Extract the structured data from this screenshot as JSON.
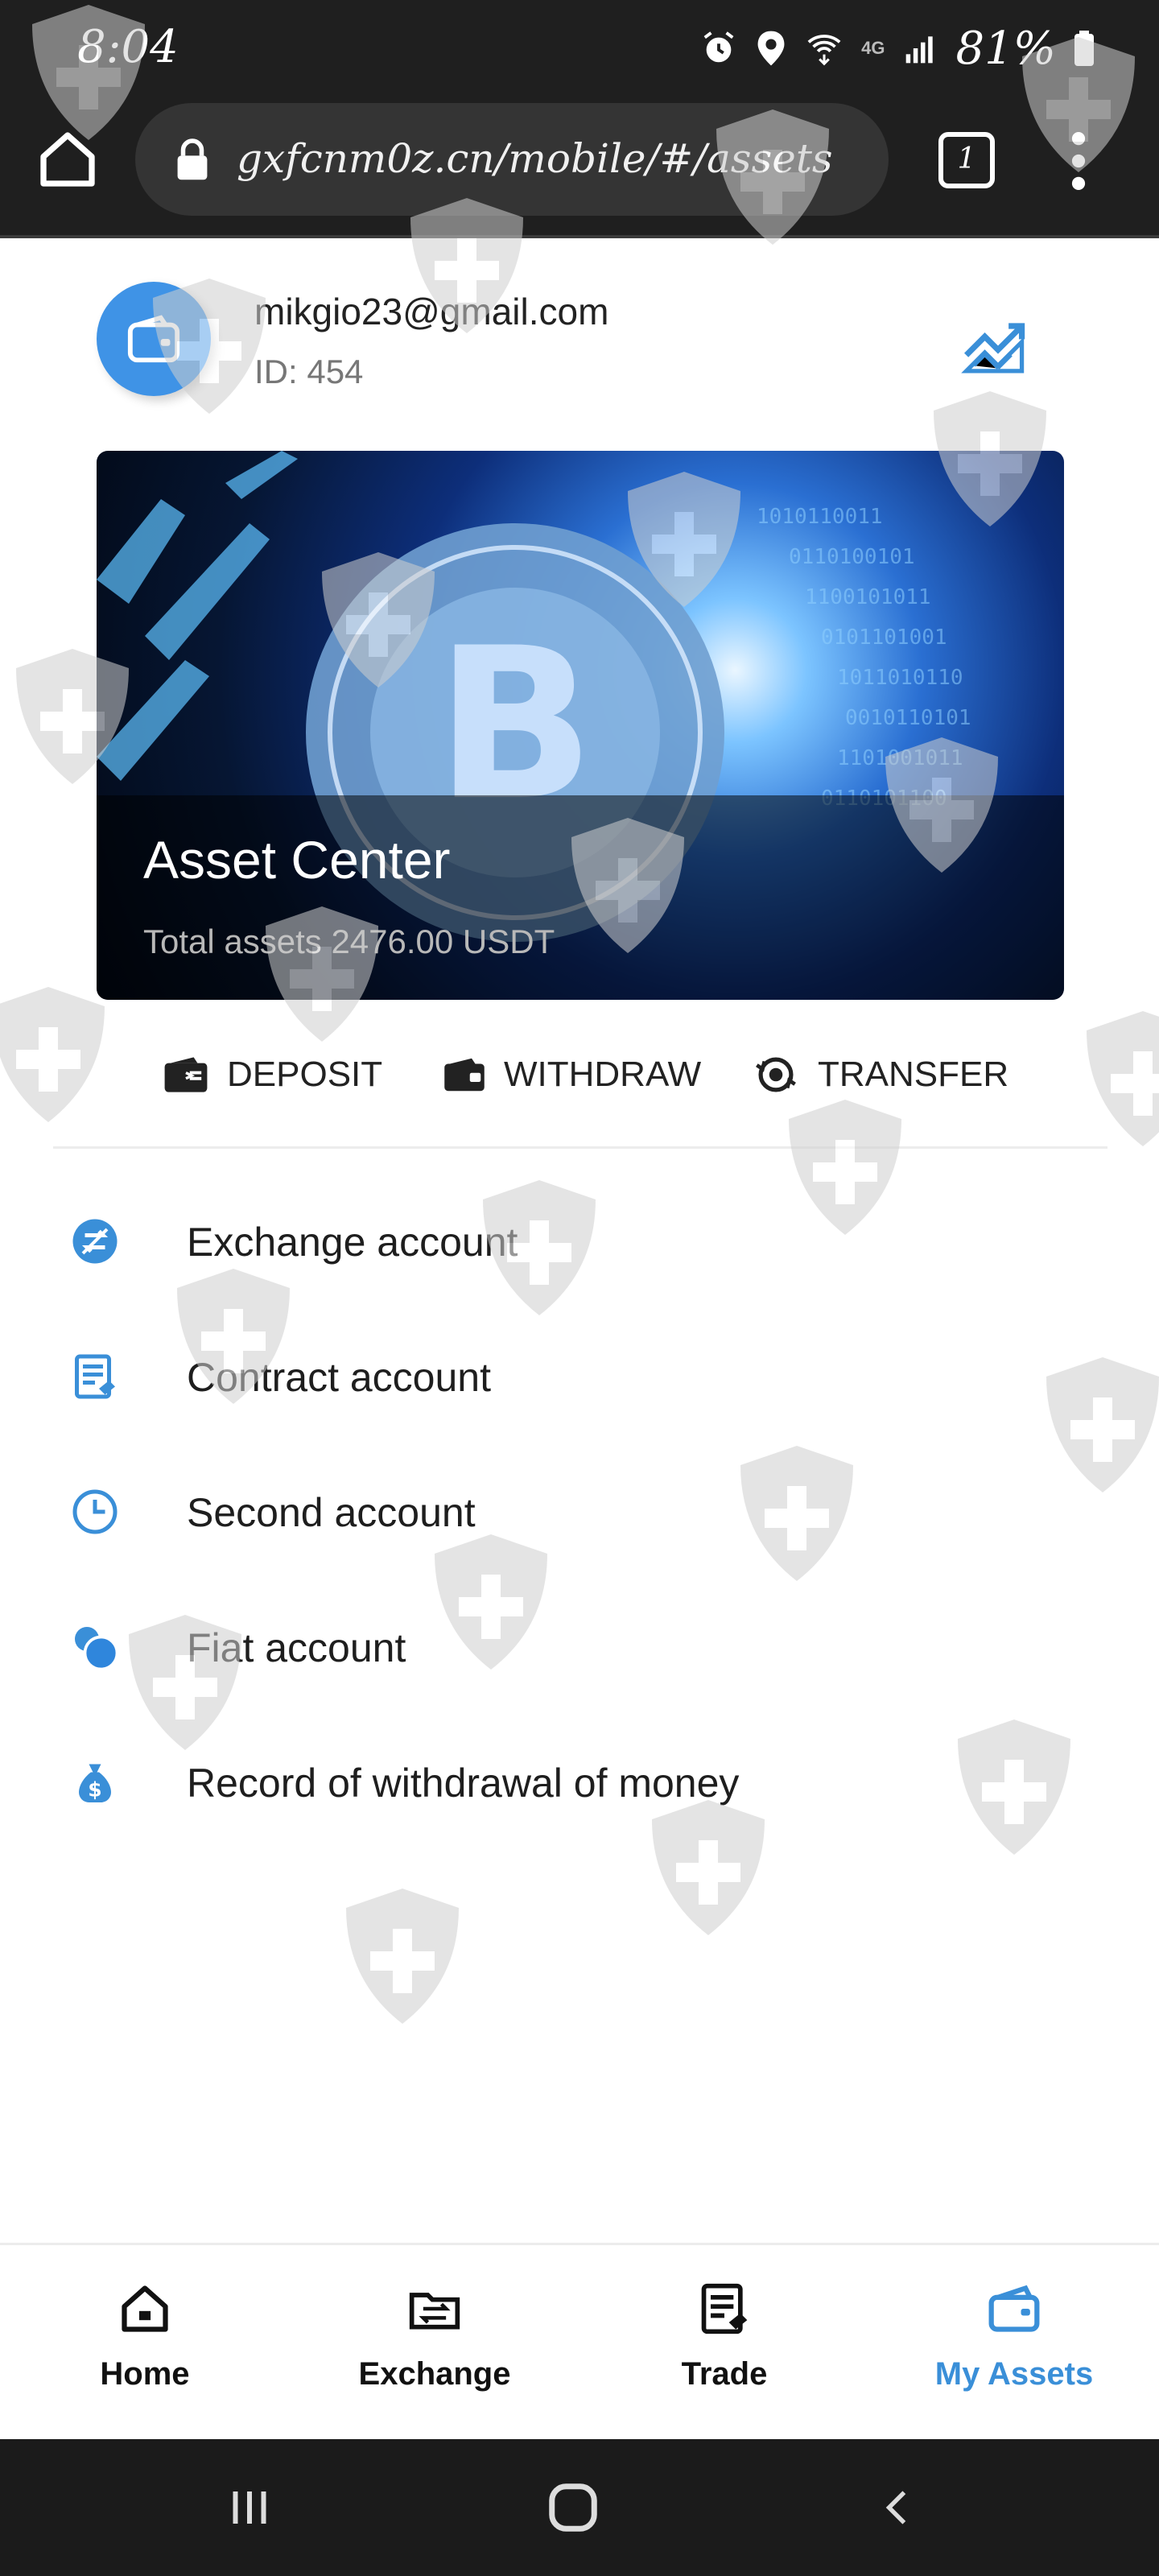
{
  "status_bar": {
    "time": "8:04",
    "network": "4G",
    "battery": "81%",
    "icons": [
      "alarm-icon",
      "location-icon",
      "wifi-icon",
      "signal-icon",
      "battery-icon"
    ]
  },
  "browser": {
    "url": "gxfcnm0z.cn/mobile/#/assets",
    "tab_count": "1"
  },
  "account": {
    "email": "mikgio23@gmail.com",
    "id": "ID: 454"
  },
  "banner": {
    "title": "Asset Center",
    "subtitle": "Total assets 2476.00 USDT"
  },
  "actions": [
    {
      "label": "DEPOSIT",
      "icon": "wallet-in-icon"
    },
    {
      "label": "WITHDRAW",
      "icon": "wallet-out-icon"
    },
    {
      "label": "TRANSFER",
      "icon": "transfer-icon"
    }
  ],
  "accounts": [
    {
      "label": "Exchange account",
      "icon": "exchange-icon"
    },
    {
      "label": "Contract account",
      "icon": "contract-icon"
    },
    {
      "label": "Second account",
      "icon": "clock-icon"
    },
    {
      "label": "Fiat account",
      "icon": "coins-icon"
    },
    {
      "label": "Record of withdrawal of money",
      "icon": "money-bag-icon"
    }
  ],
  "tabs": [
    {
      "label": "Home",
      "icon": "home-icon",
      "active": false
    },
    {
      "label": "Exchange",
      "icon": "exchange-folder-icon",
      "active": false
    },
    {
      "label": "Trade",
      "icon": "trade-icon",
      "active": false
    },
    {
      "label": "My Assets",
      "icon": "wallet-icon",
      "active": true
    }
  ],
  "colors": {
    "accent": "#3a8fd8",
    "chrome_bg": "#1f1f1f",
    "urlbox_bg": "#343434"
  }
}
